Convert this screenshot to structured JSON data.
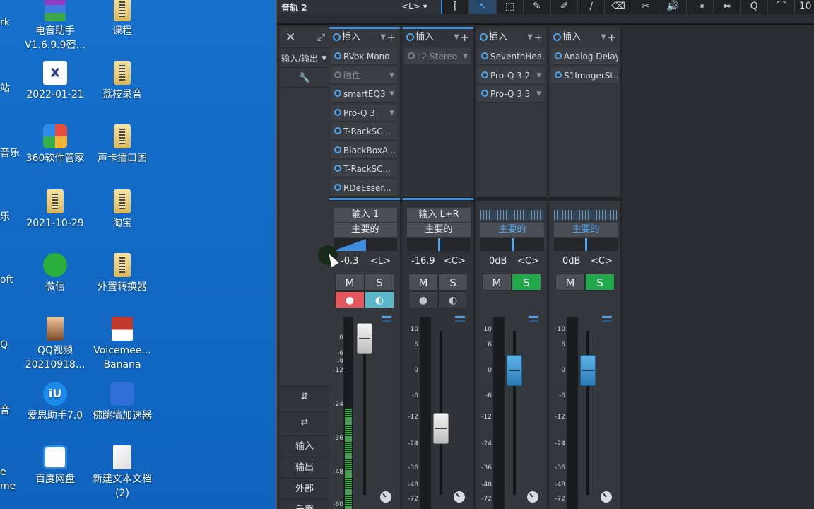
{
  "desktop": {
    "icons": [
      {
        "label": "电音助手 V1.6.9.9密...",
        "icon": "rar-icon"
      },
      {
        "label": "课程",
        "icon": "folder-icon"
      },
      {
        "label": "2022-01-21",
        "icon": "app-icon"
      },
      {
        "label": "荔枝录音",
        "icon": "folder-icon"
      },
      {
        "label": "360软件管家",
        "icon": "manager-icon"
      },
      {
        "label": "声卡插口图",
        "icon": "folder-icon"
      },
      {
        "label": "2021-10-29",
        "icon": "folder-icon"
      },
      {
        "label": "淘宝",
        "icon": "folder-icon"
      },
      {
        "label": "微信",
        "icon": "wechat-icon"
      },
      {
        "label": "外置转换器",
        "icon": "folder-icon"
      },
      {
        "label": "QQ视频 20210918...",
        "icon": "photo-icon"
      },
      {
        "label": "Voicemee... Banana",
        "icon": "voicemeeter-icon"
      },
      {
        "label": "爱思助手7.0",
        "icon": "i4-icon"
      },
      {
        "label": "佛跳墙加速器",
        "icon": "vpn-icon"
      },
      {
        "label": "百度网盘",
        "icon": "baidu-icon"
      },
      {
        "label": "新建文本文档 (2)",
        "icon": "text-doc-icon"
      }
    ],
    "edge_labels": [
      "rk",
      "站",
      "音乐",
      "乐",
      "oft",
      "Q",
      "音",
      "e",
      "me"
    ]
  },
  "daw": {
    "track_name": "音轨 2",
    "pan_display": "<L>",
    "tools": [
      "[",
      "↖",
      "⬚",
      "✎",
      "✐",
      "∕",
      "⌫",
      "✂",
      "🔊",
      "⇥",
      "⇔",
      "Q",
      "⌒",
      "10"
    ],
    "left_panel": {
      "close": "✕",
      "expand": "⤢",
      "io_label": "输入/输出",
      "wrench": "🔧",
      "nav_up_down": "⇵",
      "nav_left_right": "⇄",
      "buttons": [
        "输入",
        "输出",
        "外部",
        "乐器"
      ]
    },
    "insert_label": "插入",
    "channels": [
      {
        "plugins": [
          {
            "name": "RVox Mono",
            "on": true
          },
          {
            "name": "磁性",
            "on": false
          },
          {
            "name": "smartEQ3",
            "on": true
          },
          {
            "name": "Pro-Q 3",
            "on": true
          },
          {
            "name": "T-RackSC...",
            "on": true
          },
          {
            "name": "BlackBoxA...",
            "on": true
          },
          {
            "name": "T-RackSC...",
            "on": true
          },
          {
            "name": "RDeEsser...",
            "on": true
          }
        ],
        "input": "输入 1",
        "output": "主要的",
        "volume": "-0.3",
        "pan": "<L>",
        "mute": "M",
        "solo": "S",
        "solo_on": false,
        "record": "●",
        "monitor": "◐",
        "fader_db": -0.3,
        "meter_level": 0.95,
        "scale": [
          "0",
          "-6",
          "-9",
          "-12",
          "-24",
          "-36",
          "-48",
          "-60"
        ]
      },
      {
        "plugins": [
          {
            "name": "L2 Stereo",
            "on": false
          }
        ],
        "input": "输入 L+R",
        "output": "主要的",
        "volume": "-16.9",
        "pan": "<C>",
        "mute": "M",
        "solo": "S",
        "solo_on": false,
        "record": "●",
        "monitor": "◐",
        "fader_db": -16.9,
        "meter_level": 0,
        "scale": [
          "10",
          "6",
          "0",
          "-6",
          "-12",
          "-24",
          "-36",
          "-48",
          "-72"
        ]
      },
      {
        "plugins": [
          {
            "name": "SeventhHea...",
            "on": true
          },
          {
            "name": "Pro-Q 3 2",
            "on": true
          },
          {
            "name": "Pro-Q 3 3",
            "on": true
          }
        ],
        "input": "",
        "output": "主要的",
        "volume": "0dB",
        "pan": "<C>",
        "mute": "M",
        "solo": "S",
        "solo_on": true,
        "fader_db": 0,
        "meter_level": 0,
        "scale": [
          "10",
          "6",
          "0",
          "-6",
          "-12",
          "-24",
          "-36",
          "-48",
          "-72"
        ]
      },
      {
        "plugins": [
          {
            "name": "Analog Delay",
            "on": true
          },
          {
            "name": "S1ImagerSt...",
            "on": true
          }
        ],
        "input": "",
        "output": "主要的",
        "volume": "0dB",
        "pan": "<C>",
        "mute": "M",
        "solo": "S",
        "solo_on": true,
        "fader_db": 0,
        "meter_level": 0,
        "scale": [
          "10",
          "6",
          "0",
          "-6",
          "-12",
          "-24",
          "-36",
          "-48",
          "-72"
        ]
      }
    ]
  },
  "colors": {
    "desktop_bg": "#1268c6",
    "daw_bg": "#2a2d31",
    "accent_blue": "#3e8ee0",
    "solo_green": "#21a84b",
    "record_red": "#e4555c",
    "monitor_cyan": "#5ab6c9"
  }
}
